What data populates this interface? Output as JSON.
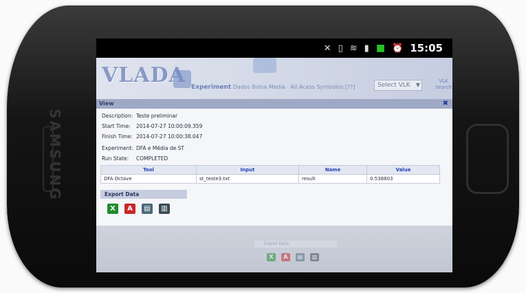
{
  "device": {
    "brand": "SAMSUNG"
  },
  "status_bar": {
    "time": "15:05",
    "battery_color": "#28c028"
  },
  "app": {
    "logo": "VLADA",
    "header_label": "Experiment",
    "header_text": "Dados Bolsa Media · All Acess Symbolos [??]",
    "select_vlk": "Select VLK",
    "vlk_search": "VLK Search"
  },
  "view": {
    "title": "View",
    "details": [
      {
        "label": "Description:",
        "value": "Teste preliminar"
      },
      {
        "label": "Start Time:",
        "value": "2014-07-27 10:00:09.359"
      },
      {
        "label": "Finish Time:",
        "value": "2014-07-27 10:00:38.047"
      },
      {
        "label": "Experiment:",
        "value": "DFA e Média de ST"
      },
      {
        "label": "Run State:",
        "value": "COMPLETED"
      }
    ],
    "table": {
      "columns": [
        "Tool",
        "Input",
        "Name",
        "Value"
      ],
      "rows": [
        [
          "DFA Octave",
          "st_teste3.txt",
          "result",
          "0.538803"
        ]
      ]
    },
    "export_title": "Export Data",
    "export_icons": [
      "excel-icon",
      "pdf-icon",
      "csv-icon",
      "xml-icon"
    ]
  },
  "background_export": {
    "title": "Export Data"
  },
  "colors": {
    "accent": "#2542b8",
    "header_bar": "#9fa9c5"
  }
}
